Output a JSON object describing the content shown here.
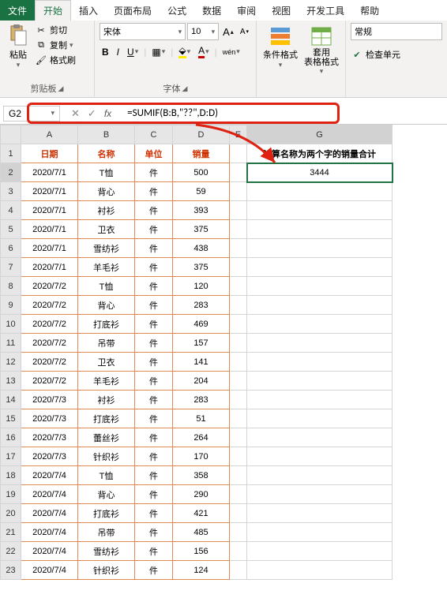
{
  "menu": {
    "file": "文件",
    "home": "开始",
    "insert": "插入",
    "layout": "页面布局",
    "formulas": "公式",
    "data": "数据",
    "review": "审阅",
    "view": "视图",
    "dev": "开发工具",
    "help": "帮助"
  },
  "ribbon": {
    "clipboard": {
      "paste": "粘贴",
      "cut": "剪切",
      "copy": "复制",
      "format_painter": "格式刷",
      "group": "剪贴板"
    },
    "font": {
      "name": "宋体",
      "size": "10",
      "bold": "B",
      "italic": "I",
      "underline": "U",
      "group": "字体",
      "wen": "wén"
    },
    "cond": {
      "label": "条件格式"
    },
    "table_fmt": {
      "label": "套用\n表格格式"
    },
    "number": {
      "label": "常规",
      "check": "检查单元"
    }
  },
  "fx": {
    "namebox": "G2",
    "formula": "=SUMIF(B:B,\"??\",D:D)"
  },
  "headers": {
    "A": "日期",
    "B": "名称",
    "C": "单位",
    "D": "销量",
    "G": "计算名称为两个字的销量合计"
  },
  "result": "3444",
  "cols": [
    "A",
    "B",
    "C",
    "D",
    "E",
    "G"
  ],
  "rows": [
    {
      "n": "1"
    },
    {
      "n": "2",
      "a": "2020/7/1",
      "b": "T恤",
      "c": "件",
      "d": "500"
    },
    {
      "n": "3",
      "a": "2020/7/1",
      "b": "背心",
      "c": "件",
      "d": "59"
    },
    {
      "n": "4",
      "a": "2020/7/1",
      "b": "衬衫",
      "c": "件",
      "d": "393"
    },
    {
      "n": "5",
      "a": "2020/7/1",
      "b": "卫衣",
      "c": "件",
      "d": "375"
    },
    {
      "n": "6",
      "a": "2020/7/1",
      "b": "雪纺衫",
      "c": "件",
      "d": "438"
    },
    {
      "n": "7",
      "a": "2020/7/1",
      "b": "羊毛衫",
      "c": "件",
      "d": "375"
    },
    {
      "n": "8",
      "a": "2020/7/2",
      "b": "T恤",
      "c": "件",
      "d": "120"
    },
    {
      "n": "9",
      "a": "2020/7/2",
      "b": "背心",
      "c": "件",
      "d": "283"
    },
    {
      "n": "10",
      "a": "2020/7/2",
      "b": "打底衫",
      "c": "件",
      "d": "469"
    },
    {
      "n": "11",
      "a": "2020/7/2",
      "b": "吊带",
      "c": "件",
      "d": "157"
    },
    {
      "n": "12",
      "a": "2020/7/2",
      "b": "卫衣",
      "c": "件",
      "d": "141"
    },
    {
      "n": "13",
      "a": "2020/7/2",
      "b": "羊毛衫",
      "c": "件",
      "d": "204"
    },
    {
      "n": "14",
      "a": "2020/7/3",
      "b": "衬衫",
      "c": "件",
      "d": "283"
    },
    {
      "n": "15",
      "a": "2020/7/3",
      "b": "打底衫",
      "c": "件",
      "d": "51"
    },
    {
      "n": "16",
      "a": "2020/7/3",
      "b": "蕾丝衫",
      "c": "件",
      "d": "264"
    },
    {
      "n": "17",
      "a": "2020/7/3",
      "b": "针织衫",
      "c": "件",
      "d": "170"
    },
    {
      "n": "18",
      "a": "2020/7/4",
      "b": "T恤",
      "c": "件",
      "d": "358"
    },
    {
      "n": "19",
      "a": "2020/7/4",
      "b": "背心",
      "c": "件",
      "d": "290"
    },
    {
      "n": "20",
      "a": "2020/7/4",
      "b": "打底衫",
      "c": "件",
      "d": "421"
    },
    {
      "n": "21",
      "a": "2020/7/4",
      "b": "吊带",
      "c": "件",
      "d": "485"
    },
    {
      "n": "22",
      "a": "2020/7/4",
      "b": "雪纺衫",
      "c": "件",
      "d": "156"
    },
    {
      "n": "23",
      "a": "2020/7/4",
      "b": "针织衫",
      "c": "件",
      "d": "124"
    }
  ]
}
